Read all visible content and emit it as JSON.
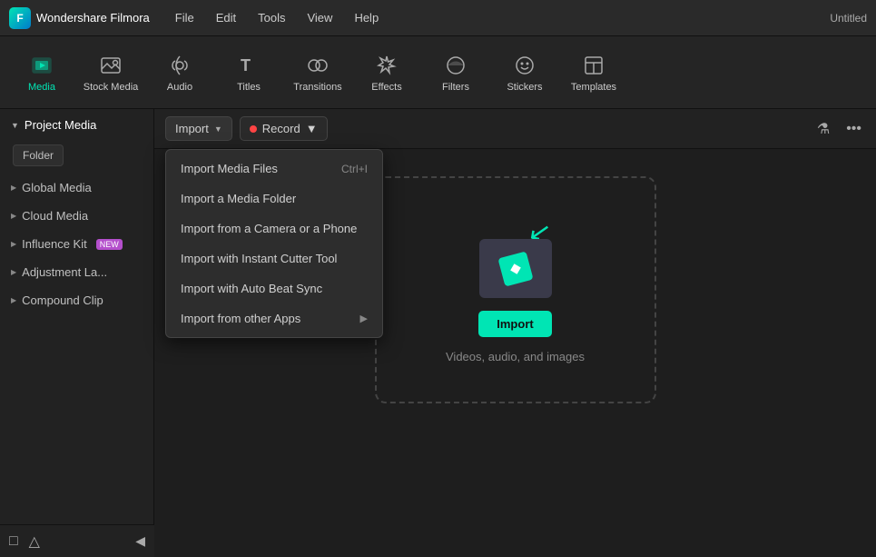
{
  "app": {
    "name": "Wondershare Filmora",
    "title": "Untitled"
  },
  "menubar": {
    "items": [
      "File",
      "Edit",
      "Tools",
      "View",
      "Help"
    ]
  },
  "toolbar": {
    "items": [
      {
        "id": "media",
        "label": "Media",
        "active": true
      },
      {
        "id": "stock-media",
        "label": "Stock Media",
        "active": false
      },
      {
        "id": "audio",
        "label": "Audio",
        "active": false
      },
      {
        "id": "titles",
        "label": "Titles",
        "active": false
      },
      {
        "id": "transitions",
        "label": "Transitions",
        "active": false
      },
      {
        "id": "effects",
        "label": "Effects",
        "active": false
      },
      {
        "id": "filters",
        "label": "Filters",
        "active": false
      },
      {
        "id": "stickers",
        "label": "Stickers",
        "active": false
      },
      {
        "id": "templates",
        "label": "Templates",
        "active": false
      }
    ]
  },
  "sidebar": {
    "section_label": "Project Media",
    "folder_button": "Folder",
    "sections": [
      {
        "id": "global-media",
        "label": "Global Media",
        "badge": null
      },
      {
        "id": "cloud-media",
        "label": "Cloud Media",
        "badge": null
      },
      {
        "id": "influence-kit",
        "label": "Influence Kit",
        "badge": "NEW"
      },
      {
        "id": "adjustment-la",
        "label": "Adjustment La...",
        "badge": null
      },
      {
        "id": "compound-clip",
        "label": "Compound Clip",
        "badge": null
      }
    ]
  },
  "content_bar": {
    "import_label": "Import",
    "record_label": "Record"
  },
  "dropdown_menu": {
    "items": [
      {
        "id": "import-media-files",
        "label": "Import Media Files",
        "shortcut": "Ctrl+I",
        "has_sub": false
      },
      {
        "id": "import-media-folder",
        "label": "Import a Media Folder",
        "shortcut": "",
        "has_sub": false
      },
      {
        "id": "import-camera",
        "label": "Import from a Camera or a Phone",
        "shortcut": "",
        "has_sub": false
      },
      {
        "id": "import-instant-cutter",
        "label": "Import with Instant Cutter Tool",
        "shortcut": "",
        "has_sub": false
      },
      {
        "id": "import-auto-beat",
        "label": "Import with Auto Beat Sync",
        "shortcut": "",
        "has_sub": false
      },
      {
        "id": "import-other-apps",
        "label": "Import from other Apps",
        "shortcut": "",
        "has_sub": true
      }
    ]
  },
  "dropzone": {
    "import_button_label": "Import",
    "subtitle": "Videos, audio, and images"
  },
  "colors": {
    "accent": "#00e5b4",
    "badge_new": "#b44fcc"
  }
}
